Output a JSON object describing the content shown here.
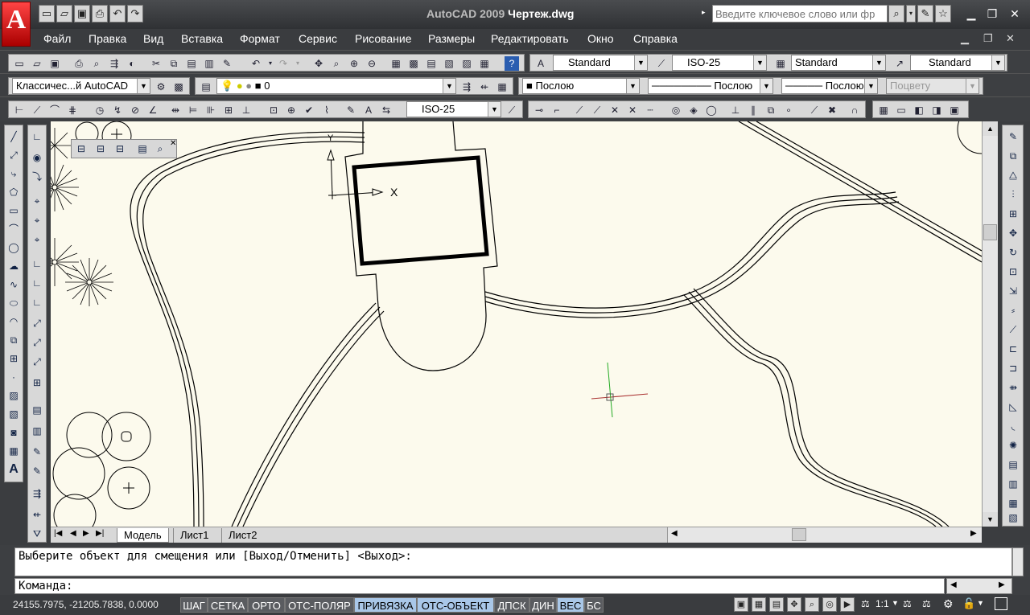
{
  "window": {
    "app_name": "AutoCAD 2009",
    "doc_name": "Чертеж.dwg",
    "search_placeholder": "Введите ключевое слово или фр"
  },
  "menu": [
    "Файл",
    "Правка",
    "Вид",
    "Вставка",
    "Формат",
    "Сервис",
    "Рисование",
    "Размеры",
    "Редактировать",
    "Окно",
    "Справка"
  ],
  "styles_toolbar": {
    "text_style": "Standard",
    "dim_style": "ISO-25",
    "table_style": "Standard",
    "mleader_style": "Standard"
  },
  "layers_toolbar": {
    "workspace": "Классичес...й AutoCAD",
    "layer": "0",
    "color": "Послою",
    "linetype": "Послою",
    "lineweight": "Послою",
    "plot_style": "Поцвету"
  },
  "dim_toolbar": {
    "dim_style": "ISO-25"
  },
  "ucs": {
    "x_label": "X",
    "y_label": "Y"
  },
  "layout_tabs": [
    "Модель",
    "Лист1",
    "Лист2"
  ],
  "command": {
    "history": "Выберите объект для смещения или [Выход/Отменить] <Выход>:",
    "prompt": "Команда:"
  },
  "status": {
    "coordinates": "24155.7975, -21205.7838, 0.0000",
    "toggles": [
      {
        "label": "ШАГ",
        "on": false
      },
      {
        "label": "СЕТКА",
        "on": false
      },
      {
        "label": "ОРТО",
        "on": false
      },
      {
        "label": "ОТС-ПОЛЯР",
        "on": false
      },
      {
        "label": "ПРИВЯЗКА",
        "on": true
      },
      {
        "label": "ОТС-ОБЪЕКТ",
        "on": true
      },
      {
        "label": "ДПСК",
        "on": false
      },
      {
        "label": "ДИН",
        "on": false
      },
      {
        "label": "ВЕС",
        "on": true
      },
      {
        "label": "БС",
        "on": false
      }
    ],
    "annotation_scale": "1:1"
  }
}
